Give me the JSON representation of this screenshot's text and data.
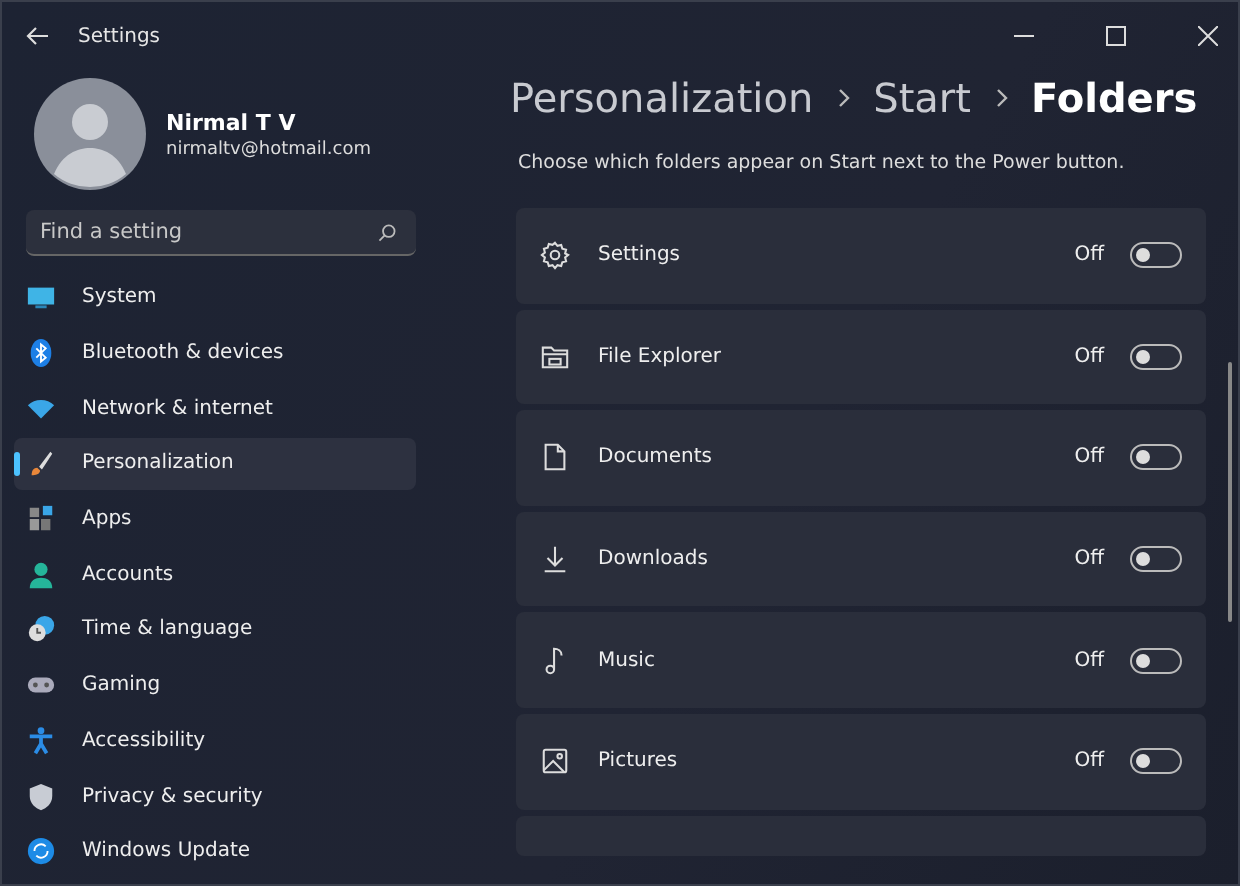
{
  "window": {
    "title": "Settings"
  },
  "profile": {
    "name": "Nirmal T V",
    "email": "nirmaltv@hotmail.com"
  },
  "search": {
    "placeholder": "Find a setting"
  },
  "sidebar": {
    "items": [
      {
        "label": "System",
        "selected": false
      },
      {
        "label": "Bluetooth & devices",
        "selected": false
      },
      {
        "label": "Network & internet",
        "selected": false
      },
      {
        "label": "Personalization",
        "selected": true
      },
      {
        "label": "Apps",
        "selected": false
      },
      {
        "label": "Accounts",
        "selected": false
      },
      {
        "label": "Time & language",
        "selected": false
      },
      {
        "label": "Gaming",
        "selected": false
      },
      {
        "label": "Accessibility",
        "selected": false
      },
      {
        "label": "Privacy & security",
        "selected": false
      },
      {
        "label": "Windows Update",
        "selected": false
      }
    ]
  },
  "breadcrumb": [
    "Personalization",
    "Start",
    "Folders"
  ],
  "description": "Choose which folders appear on Start next to the Power button.",
  "folders": [
    {
      "label": "Settings",
      "state": "Off",
      "on": false
    },
    {
      "label": "File Explorer",
      "state": "Off",
      "on": false
    },
    {
      "label": "Documents",
      "state": "Off",
      "on": false
    },
    {
      "label": "Downloads",
      "state": "Off",
      "on": false
    },
    {
      "label": "Music",
      "state": "Off",
      "on": false
    },
    {
      "label": "Pictures",
      "state": "Off",
      "on": false
    }
  ]
}
